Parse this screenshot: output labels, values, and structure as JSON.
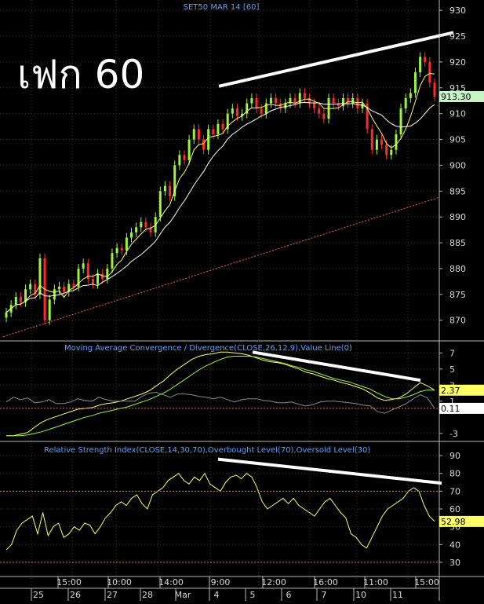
{
  "chart_data": [
    {
      "type": "candlestick",
      "title": "SET50 MAR 14   [60]",
      "annotation": "เฟก 60",
      "ylim": [
        866,
        932
      ],
      "y_ticks": [
        870,
        875,
        880,
        885,
        890,
        895,
        900,
        905,
        910,
        915,
        920,
        925,
        930
      ],
      "last_price_label": "913.30",
      "last_price": 913.3,
      "grid": true,
      "colors": {
        "up": "#9cf53b",
        "down": "#ff2b2b",
        "ma_fast": "#ffff66",
        "ma_slow": "#ffffff",
        "trend": "#ff5a5a"
      },
      "close": [
        871.5,
        873,
        874.5,
        873.5,
        876,
        877,
        875,
        882,
        870,
        874,
        876,
        876.5,
        875.5,
        877,
        876.5,
        880,
        881,
        878,
        877,
        879,
        878,
        880,
        883,
        884,
        883.5,
        886,
        887,
        888,
        889,
        888,
        887,
        890,
        895,
        896,
        894,
        900,
        902,
        901,
        905,
        907,
        905,
        903,
        907,
        906,
        908,
        907,
        910,
        911,
        909.5,
        910,
        912,
        913,
        911,
        910,
        912,
        913,
        912,
        911,
        912,
        913,
        912,
        914,
        913,
        912,
        911,
        910,
        909,
        913,
        912,
        911.5,
        913,
        912,
        913,
        911,
        912,
        907,
        903,
        905,
        904,
        902,
        903,
        906,
        911,
        913,
        914,
        918,
        921,
        920,
        916,
        913.3
      ]
    },
    {
      "type": "line",
      "title": "Moving Average Convergence / Divergence(CLOSE,26,12,9),Value Line(0)",
      "ylim": [
        -4,
        8.5
      ],
      "y_ticks": [
        -3,
        1,
        3,
        5,
        7
      ],
      "last_values": [
        "2.37",
        "0.11"
      ],
      "series": [
        {
          "values": [
            -3.3,
            -3.3,
            -3.1,
            -2.9,
            -2.2,
            -1.6,
            -1.2,
            -0.9,
            -0.6,
            -0.3,
            0,
            0.1,
            0.2,
            0.5,
            0.7,
            0.8,
            1,
            1.3,
            1.6,
            1.9,
            2.3,
            2.9,
            3.5,
            4.3,
            5,
            5.6,
            6.2,
            6.6,
            6.8,
            6.9,
            7.1,
            7.1,
            7,
            6.9,
            6.7,
            6.4,
            6.1,
            5.9,
            5.8,
            5.6,
            5.3,
            5,
            4.6,
            4.4,
            4.1,
            3.8,
            3.6,
            3.3,
            3.1,
            2.8,
            2.5,
            2,
            1.4,
            1.1,
            1.2,
            1.4,
            1.9,
            2.6,
            3.3,
            2.9,
            2.37
          ]
        },
        {
          "values": [
            -3.3,
            -3.3,
            -3.3,
            -3.2,
            -3,
            -2.8,
            -2.5,
            -2.2,
            -1.9,
            -1.6,
            -1.3,
            -1,
            -0.8,
            -0.5,
            -0.3,
            -0.1,
            0.1,
            0.3,
            0.6,
            0.9,
            1.2,
            1.6,
            2,
            2.5,
            3.1,
            3.7,
            4.3,
            4.9,
            5.4,
            5.8,
            6.2,
            6.5,
            6.6,
            6.6,
            6.6,
            6.5,
            6.3,
            6.1,
            5.9,
            5.7,
            5.4,
            5.2,
            4.9,
            4.7,
            4.4,
            4.1,
            3.8,
            3.6,
            3.4,
            3.1,
            2.8,
            2.5,
            2,
            1.6,
            1.3,
            1.3,
            1.5,
            1.8,
            2.2,
            2.4,
            2.37
          ]
        },
        {
          "values": [
            0.9,
            1.5,
            1.2,
            1.4,
            0.8,
            0.9,
            1.2,
            0.7,
            0.7,
            0.9,
            1.3,
            1.1,
            1,
            1.5,
            1.2,
            1,
            1,
            1,
            1,
            1.6,
            2,
            2.1,
            1.8,
            1.5,
            1.9,
            1.9,
            1.8,
            1.6,
            1.5,
            1.3,
            1.5,
            1.2,
            0.9,
            1.2,
            1.3,
            1.3,
            1.1,
            1,
            0.8,
            0.8,
            0.9,
            0.6,
            0.4,
            0.6,
            0.9,
            1,
            1,
            0.9,
            0.8,
            0.7,
            0.5,
            0.4,
            -0.3,
            -0.5,
            -0.1,
            0.3,
            0.7,
            1.3,
            1.8,
            1.4,
            0.11
          ]
        }
      ]
    },
    {
      "type": "line",
      "title": "Relative Strength Index(CLOSE,14,30,70),Overbought Level(70),Oversold Level(30)",
      "ylim": [
        22,
        98
      ],
      "y_ticks": [
        30,
        40,
        50,
        60,
        70,
        80,
        90
      ],
      "levels": [
        70,
        30
      ],
      "last_value_label": "52.98",
      "series": [
        {
          "values": [
            37,
            40,
            48,
            52,
            54,
            56,
            46,
            58,
            45,
            50,
            52,
            44,
            46,
            50,
            48,
            52,
            51,
            46,
            50,
            55,
            58,
            62,
            64,
            62,
            66,
            68,
            63,
            60,
            68,
            70,
            72,
            76,
            78,
            80,
            76,
            74,
            78,
            76,
            80,
            74,
            72,
            70,
            75,
            78,
            79,
            77,
            80,
            78,
            72,
            64,
            60,
            62,
            64,
            66,
            63,
            66,
            62,
            60,
            58,
            56,
            60,
            64,
            66,
            62,
            58,
            55,
            46,
            44,
            40,
            38,
            44,
            50,
            56,
            60,
            62,
            64,
            66,
            70,
            72,
            70,
            62,
            56,
            52.98
          ]
        }
      ]
    }
  ],
  "x_axis": {
    "time_labels": [
      "15:00",
      "10:00",
      "14:00",
      "9:00",
      "12:00",
      "16:00",
      "11:00",
      "15:00"
    ],
    "date_labels": [
      "25",
      "26",
      "27",
      "28",
      "Mar",
      "4",
      "5",
      "6",
      "7",
      "10",
      "11"
    ]
  }
}
